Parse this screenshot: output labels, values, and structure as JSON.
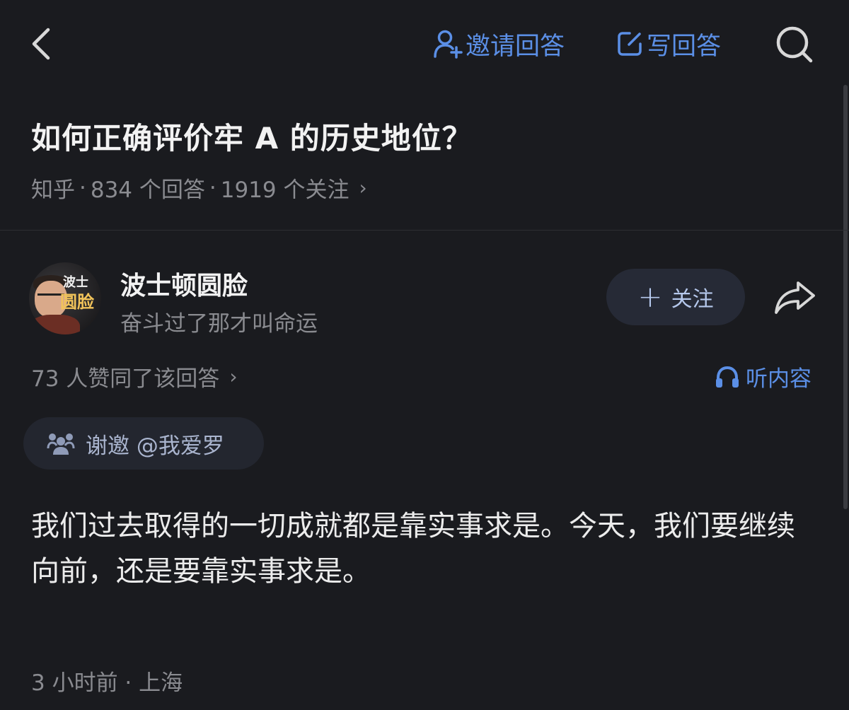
{
  "topbar": {
    "invite_label": "邀请回答",
    "write_label": "写回答"
  },
  "question": {
    "title": "如何正确评价牢 A 的历史地位？",
    "source": "知乎",
    "separator": "·",
    "answers_count": "834 个回答",
    "followers_count": "1919 个关注"
  },
  "author": {
    "name": "波士顿圆脸",
    "bio": "奋斗过了那才叫命运",
    "avatar_tag_line1": "波士",
    "avatar_tag_line2": "圆脸",
    "follow_label": "关注"
  },
  "answer": {
    "votes_text": "73 人赞同了该回答",
    "listen_label": "听内容",
    "thanks_text": "谢邀 @我爱罗",
    "body": "我们过去取得的一切成就都是靠实事求是。今天，我们要继续向前，还是要靠实事求是。",
    "post_time_location": "3 小时前 · 上海"
  },
  "colors": {
    "background": "#1a1b1f",
    "accent": "#5b8fe6",
    "muted_text": "#8a8b90",
    "follow_button_bg": "#262a36"
  },
  "icons": {
    "back": "chevron-left-icon",
    "invite": "add-user-icon",
    "write": "edit-icon",
    "search": "search-icon",
    "share": "share-arrow-icon",
    "listen": "headphones-icon",
    "thanks": "people-icon"
  }
}
